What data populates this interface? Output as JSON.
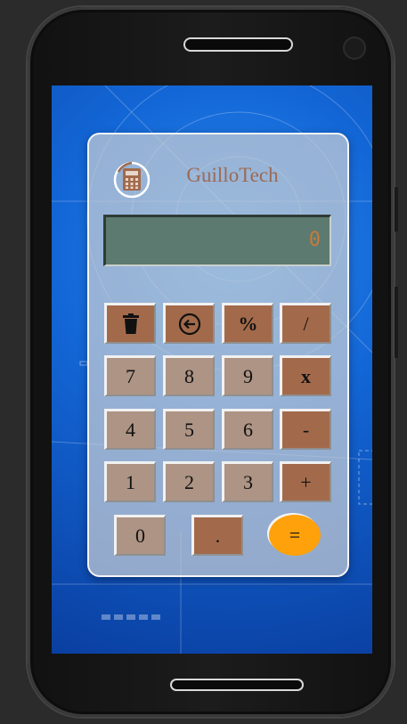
{
  "app": {
    "brand": "GuilloTech",
    "logo_icon": "calculator-icon",
    "colors": {
      "accent": "#a26a4b",
      "equals": "#ffa10a",
      "display": "#5d7a70",
      "display_text": "#c87a3a"
    }
  },
  "display": {
    "value": "0"
  },
  "keys": {
    "clear_icon": "trash-icon",
    "backspace_icon": "backspace-arrow-icon",
    "percent": "%",
    "divide": "/",
    "seven": "7",
    "eight": "8",
    "nine": "9",
    "multiply": "x",
    "four": "4",
    "five": "5",
    "six": "6",
    "minus": "-",
    "one": "1",
    "two": "2",
    "three": "3",
    "plus": "+",
    "zero": "0",
    "dot": ".",
    "equals": "="
  }
}
